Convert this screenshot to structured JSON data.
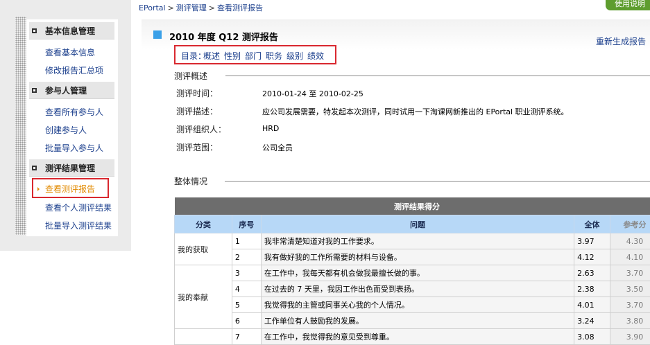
{
  "sidebar": {
    "groups": [
      {
        "title": "基本信息管理",
        "items": [
          "查看基本信息",
          "修改报告汇总项"
        ]
      },
      {
        "title": "参与人管理",
        "items": [
          "查看所有参与人",
          "创建参与人",
          "批量导入参与人"
        ]
      },
      {
        "title": "测评结果管理",
        "items": [
          "查看测评报告",
          "查看个人测评结果",
          "批量导入测评结果"
        ]
      }
    ]
  },
  "breadcrumb": {
    "items": [
      "EPortal",
      "测评管理",
      "查看测评报告"
    ],
    "separator": ">"
  },
  "help_button": "使用说明",
  "report": {
    "title": "2010 年度 Q12 测评报告",
    "regenerate": "重新生成报告",
    "toc_label": "目录：",
    "toc_links": [
      "概述",
      "性别",
      "部门",
      "职务",
      "级别",
      "绩效"
    ]
  },
  "overview": {
    "section_title": "测评概述",
    "fields": [
      {
        "label": "测评时间：",
        "value": "2010-01-24 至 2010-02-25"
      },
      {
        "label": "测评描述：",
        "value": "应公司发展需要，特发起本次测评，同时试用一下淘课网新推出的 EPortal 职业测评系统。"
      },
      {
        "label": "测评组织人：",
        "value": "HRD"
      },
      {
        "label": "测评范围：",
        "value": "公司全员"
      }
    ]
  },
  "summary": {
    "section_title": "整体情况",
    "table": {
      "caption": "测评结果得分",
      "headers": [
        "分类",
        "序号",
        "问题",
        "全体",
        "参考分"
      ],
      "groups": [
        {
          "category": "我的获取",
          "rows": [
            {
              "no": "1",
              "question": "我非常清楚知道对我的工作要求。",
              "all": "3.97",
              "ref": "4.30"
            },
            {
              "no": "2",
              "question": "我有做好我的工作所需要的材料与设备。",
              "all": "4.12",
              "ref": "4.10"
            }
          ]
        },
        {
          "category": "我的奉献",
          "rows": [
            {
              "no": "3",
              "question": "在工作中，我每天都有机会做我最擅长做的事。",
              "all": "2.63",
              "ref": "3.70"
            },
            {
              "no": "4",
              "question": "在过去的 7 天里，我因工作出色而受到表扬。",
              "all": "2.38",
              "ref": "3.50"
            },
            {
              "no": "5",
              "question": "我觉得我的主管或同事关心我的个人情况。",
              "all": "4.01",
              "ref": "3.70"
            },
            {
              "no": "6",
              "question": "工作单位有人鼓励我的发展。",
              "all": "3.24",
              "ref": "3.80"
            }
          ]
        },
        {
          "category": "",
          "rows": [
            {
              "no": "7",
              "question": "在工作中，我觉得我的意见受到尊重。",
              "all": "3.08",
              "ref": "3.90"
            }
          ]
        }
      ]
    }
  },
  "colors": {
    "accent_red": "#d9282f",
    "link_blue": "#1a3e8c",
    "active_orange": "#e28a00",
    "table_header": "#b7d8f7",
    "help_green": "#5e9d2e"
  }
}
